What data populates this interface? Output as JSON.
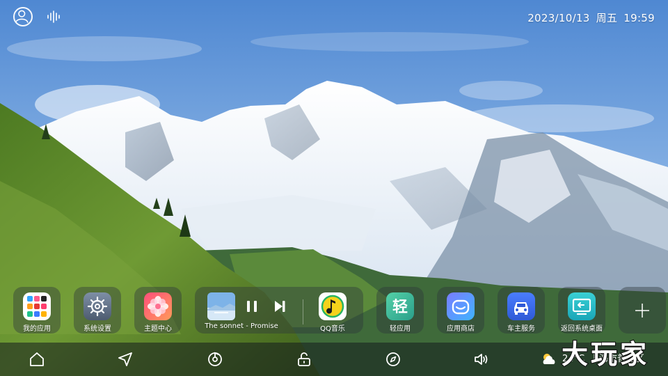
{
  "status_bar": {
    "avatar_icon": "user-avatar-icon",
    "voice_icon": "voice-wave-icon",
    "date": "2023/10/13",
    "weekday": "周五",
    "time": "19:59"
  },
  "dock": {
    "apps_left": [
      {
        "id": "my-apps",
        "label": "我的应用",
        "icon": "app-grid-icon"
      },
      {
        "id": "system-settings",
        "label": "系统设置",
        "icon": "gear-icon"
      },
      {
        "id": "theme-center",
        "label": "主题中心",
        "icon": "flower-icon"
      }
    ],
    "music": {
      "song_title": "The sonnet - Promise",
      "album_art": "album-art-icon",
      "pause_icon": "pause-icon",
      "next_icon": "next-track-icon",
      "qq_music_label": "QQ音乐",
      "qq_music_icon": "qq-music-icon"
    },
    "apps_right": [
      {
        "id": "lite-apps",
        "label": "轻应用",
        "icon": "lite-app-icon",
        "glyph": "轻"
      },
      {
        "id": "app-store",
        "label": "应用商店",
        "icon": "store-icon"
      },
      {
        "id": "car-owner-service",
        "label": "车主服务",
        "icon": "car-icon"
      },
      {
        "id": "return-desktop",
        "label": "返回系统桌面",
        "icon": "return-desktop-icon"
      }
    ],
    "add_icon": "plus-icon"
  },
  "nav_bar": {
    "items": [
      "home-icon",
      "navigation-arrow-icon",
      "music-disc-icon",
      "unlock-icon",
      "compass-icon",
      "volume-icon"
    ],
    "weather": {
      "icon": "partly-cloudy-icon",
      "temperature": "24°C",
      "location": "上海市普陀区"
    }
  },
  "watermark": {
    "text": "大玩家"
  },
  "colors": {
    "sky": "#5f97d8",
    "snow": "#f2f6fb",
    "hill_green": "#5d8a2e",
    "dock_card": "#2d373c",
    "qq_yellow": "#f6d21b",
    "lite_green": "#3fb89a",
    "car_blue": "#3a6ee8"
  }
}
